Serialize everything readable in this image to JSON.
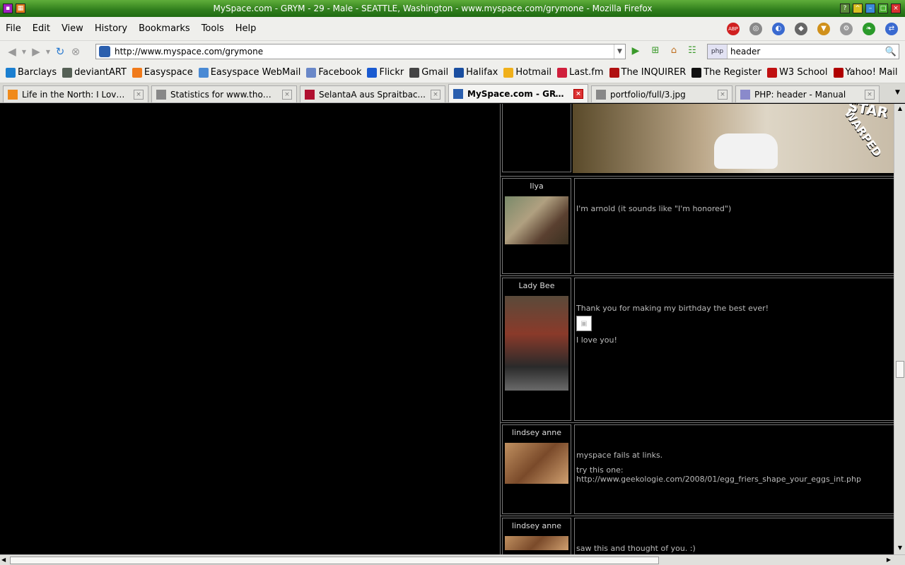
{
  "window": {
    "title": "MySpace.com - GRYM - 29 - Male - SEATTLE, Washington - www.myspace.com/grymone - Mozilla Firefox"
  },
  "menubar": {
    "items": [
      "File",
      "Edit",
      "View",
      "History",
      "Bookmarks",
      "Tools",
      "Help"
    ]
  },
  "navbar": {
    "url": "http://www.myspace.com/grymone",
    "search_value": "header",
    "search_engine": "php"
  },
  "bookmarks": [
    {
      "label": "Barclays",
      "color": "#1b7fd0"
    },
    {
      "label": "deviantART",
      "color": "#556055"
    },
    {
      "label": "Easyspace",
      "color": "#f07a1a"
    },
    {
      "label": "Easyspace WebMail",
      "color": "#4a8ad4"
    },
    {
      "label": "Facebook",
      "color": "#6a88c8"
    },
    {
      "label": "Flickr",
      "color": "#1a5ad0"
    },
    {
      "label": "Gmail",
      "color": "#444444"
    },
    {
      "label": "Halifax",
      "color": "#1a4ea0"
    },
    {
      "label": "Hotmail",
      "color": "#f0b01a"
    },
    {
      "label": "Last.fm",
      "color": "#d01f3c"
    },
    {
      "label": "The INQUIRER",
      "color": "#b01010"
    },
    {
      "label": "The Register",
      "color": "#111111"
    },
    {
      "label": "W3 School",
      "color": "#c01010"
    },
    {
      "label": "Yahoo! Mail",
      "color": "#b00000"
    }
  ],
  "tabs": [
    {
      "label": "Life in the North: I Love t...",
      "color": "#f08a1a",
      "width": 206
    },
    {
      "label": "Statistics for www.thom...",
      "color": "#888888",
      "width": 206
    },
    {
      "label": "SelantaA aus Spraitbac...",
      "color": "#b01030",
      "width": 206
    },
    {
      "label": "MySpace.com - GRYM ...",
      "color": "#2b5fae",
      "width": 198,
      "active": true
    },
    {
      "label": "portfolio/full/3.jpg",
      "color": "#888888",
      "width": 200
    },
    {
      "label": "PHP: header - Manual",
      "color": "#8a8acb",
      "width": 204
    }
  ],
  "comments": [
    {
      "name": "Ilya",
      "text": [
        "I'm arnold (it sounds like \"I'm honored\")"
      ]
    },
    {
      "name": "Lady Bee",
      "text": [
        "Thank you for making my birthday the best ever!",
        "I love you!"
      ]
    },
    {
      "name": "lindsey anne",
      "text": [
        "myspace fails at links.",
        "try this one: http://www.geekologie.com/2008/01/egg_friers_shape_your_eggs_int.php"
      ]
    },
    {
      "name": "lindsey anne",
      "text": [
        "saw this and thought of you. :)"
      ]
    }
  ],
  "star_banner": {
    "line1": "STAR",
    "line2": "WARPED"
  }
}
